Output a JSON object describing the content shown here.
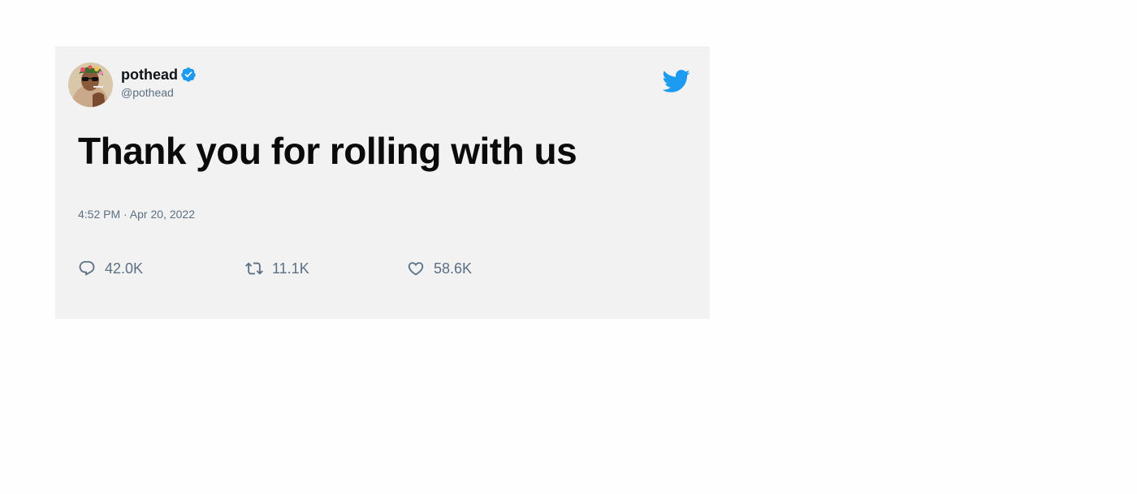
{
  "tweet": {
    "author": {
      "display_name": "pothead",
      "handle": "@pothead",
      "verified": true,
      "avatar_icon": "avatar-photo"
    },
    "text": "Thank you for rolling with us",
    "timestamp": "4:52 PM · Apr 20, 2022",
    "stats": {
      "replies": "42.0K",
      "retweets": "11.1K",
      "likes": "58.6K"
    },
    "icons": {
      "verified": "verified-badge-icon",
      "brand": "twitter-bird-icon",
      "reply": "reply-icon",
      "retweet": "retweet-icon",
      "like": "heart-icon"
    }
  },
  "colors": {
    "card_background": "#f2f2f2",
    "page_background": "#fefefe",
    "twitter_blue": "#1d9bf0",
    "muted_text": "#5b7083",
    "primary_text": "#0f1419"
  }
}
